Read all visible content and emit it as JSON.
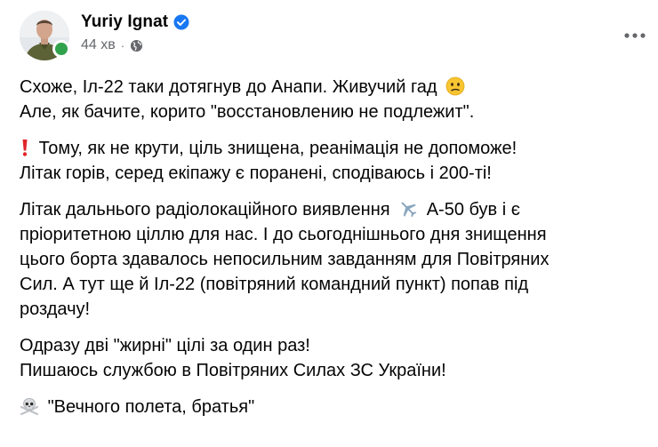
{
  "author": {
    "name": "Yuriy Ignat",
    "time": "44 хв",
    "separator": "·"
  },
  "icons": {
    "verified": "verified-badge-icon",
    "audience": "globe-icon",
    "more": "more-options-icon"
  },
  "colors": {
    "verified": "#1877f2",
    "online": "#31a24c",
    "meta_text": "#65676b"
  },
  "post": {
    "p1": {
      "l1_text": "Схоже, Іл-22 таки дотягнув до Анапи. Живучий гад",
      "l2": "Але, як бачите, корито \"восстановлению не подлежит\"."
    },
    "p2": {
      "l1_text": "Тому, як не крути, ціль знищена, реанімація не допоможе!",
      "l2": "Літак горів, серед екіпажу є поранені, сподіваюсь і 200-ті!"
    },
    "p3": {
      "l1_before": "Літак дальнього радіолокаційного виявлення",
      "l1_after": "А-50 був і є",
      "l2": "пріоритетною ціллю для нас. І до сьогоднішнього дня знищення",
      "l3": "цього борта здавалось непосильним завданням для Повітряних",
      "l4": "Сил. А тут ще й Іл-22 (повітряний командний пункт) попав під",
      "l5": "роздачу!"
    },
    "p4": {
      "l1": "Одразу дві \"жирні\" цілі за один раз!",
      "l2": "Пишаюсь службою в Повітряних Силах ЗС України!"
    },
    "p5": {
      "l1_text": "\"Вечного полета, братья\""
    }
  }
}
